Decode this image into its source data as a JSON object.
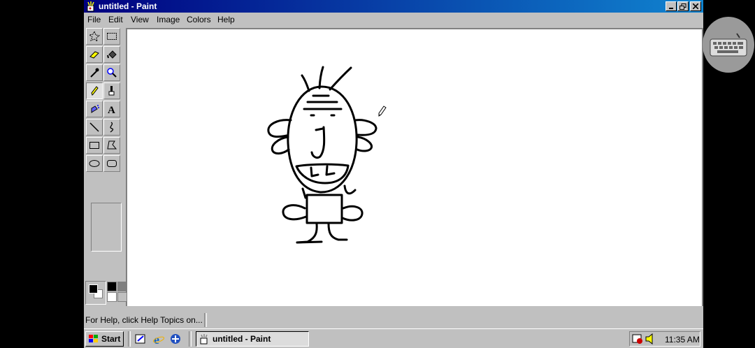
{
  "window": {
    "title": "untitled - Paint"
  },
  "menu": [
    "File",
    "Edit",
    "View",
    "Image",
    "Colors",
    "Help"
  ],
  "tools": [
    "free-form-select",
    "select",
    "eraser",
    "fill-with-color",
    "pick-color",
    "magnifier",
    "pencil",
    "brush",
    "airbrush",
    "text",
    "line",
    "curve",
    "rectangle",
    "polygon",
    "ellipse",
    "rounded-rectangle"
  ],
  "active_tool": "pencil",
  "colors": {
    "foreground": "#000000",
    "background": "#ffffff",
    "title_start": "#000080",
    "title_end": "#1084d0",
    "face": "#c0c0c0"
  },
  "status": {
    "help_text": "For Help, click Help Topics on..."
  },
  "taskbar": {
    "start_label": "Start",
    "task_label": "untitled - Paint",
    "clock": "11:35 AM"
  }
}
